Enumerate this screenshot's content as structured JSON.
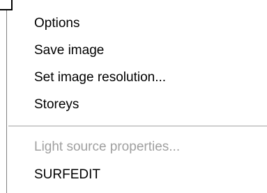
{
  "context_menu": {
    "items": [
      {
        "label": "Options",
        "enabled": true
      },
      {
        "label": "Save image",
        "enabled": true
      },
      {
        "label": "Set image resolution...",
        "enabled": true
      },
      {
        "label": "Storeys",
        "enabled": true
      },
      {
        "label": "Light source properties...",
        "enabled": false
      },
      {
        "label": "SURFEDIT",
        "enabled": true
      }
    ]
  }
}
